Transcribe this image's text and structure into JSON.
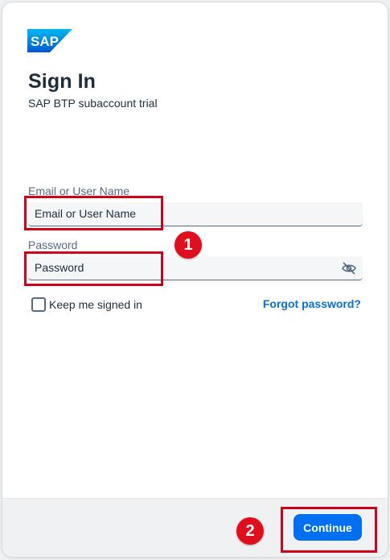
{
  "header": {
    "logo_text": "SAP",
    "title": "Sign In",
    "subtitle": "SAP BTP subaccount trial"
  },
  "form": {
    "email": {
      "label": "Email or User Name",
      "placeholder": "Email or User Name",
      "value": ""
    },
    "password": {
      "label": "Password",
      "placeholder": "Password",
      "value": "",
      "toggle_icon": "eye-slash-icon"
    },
    "keep_signed_in": {
      "label": "Keep me signed in",
      "checked": false
    },
    "forgot_password_label": "Forgot password?"
  },
  "footer": {
    "continue_label": "Continue"
  },
  "annotations": {
    "badge_1": "1",
    "badge_2": "2"
  },
  "colors": {
    "brand_blue": "#0070f2",
    "link_blue": "#0a6ed1",
    "annotation_red": "#e20d1c",
    "text_dark": "#1d2d3e"
  }
}
